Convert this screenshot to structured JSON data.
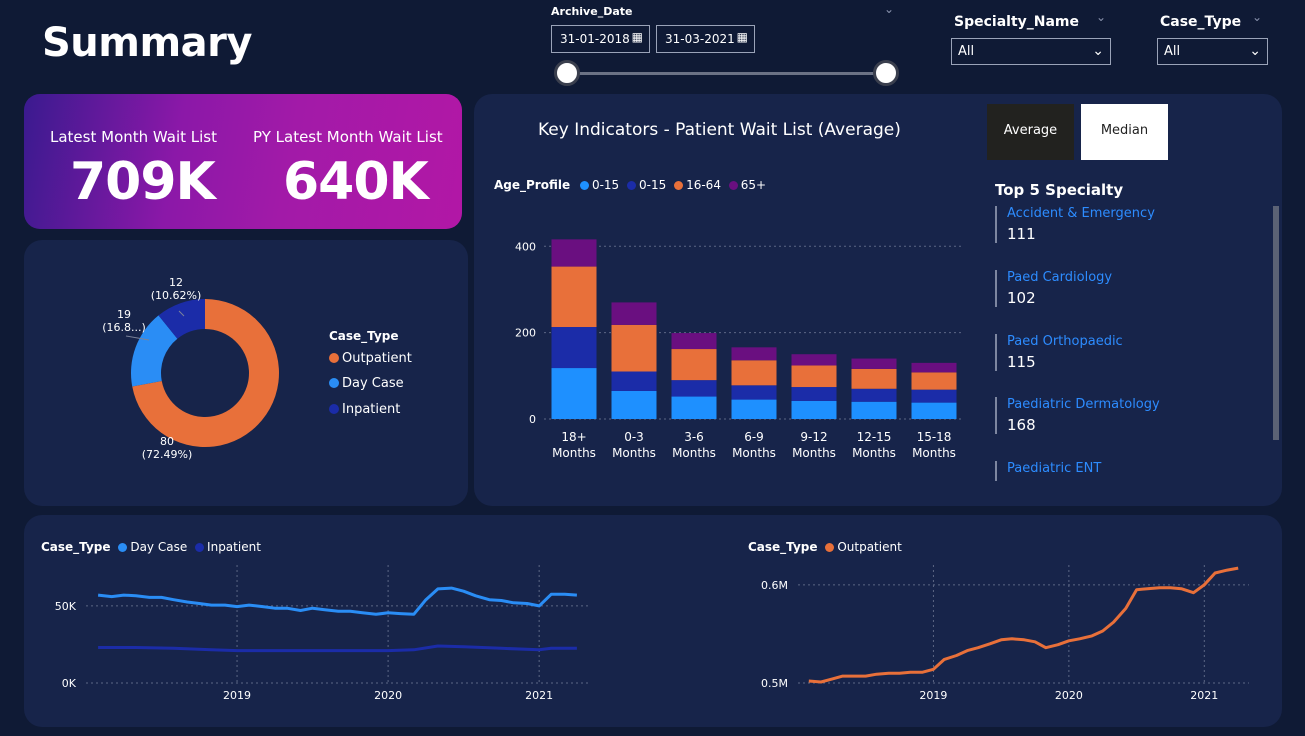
{
  "page_title": "Summary",
  "filters": {
    "archive_date": {
      "label": "Archive_Date",
      "start": "31-01-2018",
      "end": "31-03-2021"
    },
    "specialty": {
      "label": "Specialty_Name",
      "value": "All"
    },
    "case_type": {
      "label": "Case_Type",
      "value": "All"
    }
  },
  "kpis": [
    {
      "label": "Latest Month Wait List",
      "value": "709K"
    },
    {
      "label": "PY Latest Month Wait List",
      "value": "640K"
    }
  ],
  "key_indicators": {
    "title": "Key Indicators - Patient Wait List (Average)",
    "buttons": {
      "average": "Average",
      "median": "Median"
    },
    "legend_title": "Age_Profile"
  },
  "top5": {
    "title": "Top 5 Specialty",
    "items": [
      {
        "name": "Accident & Emergency",
        "value": "111"
      },
      {
        "name": "Paed Cardiology",
        "value": "102"
      },
      {
        "name": "Paed Orthopaedic",
        "value": "115"
      },
      {
        "name": "Paediatric Dermatology",
        "value": "168"
      },
      {
        "name": "Paediatric ENT",
        "value": ""
      }
    ]
  },
  "colors": {
    "outpatient": "#e8703a",
    "day_case": "#2a8df5",
    "inpatient": "#1b2ca8",
    "age_0_15_a": "#1e90ff",
    "age_0_15_b": "#1b2ca8",
    "age_16_64": "#e8703a",
    "age_65_plus": "#6a0f80"
  },
  "chart_data": [
    {
      "type": "pie",
      "legend_title": "Case_Type",
      "categories": [
        "Outpatient",
        "Day Case",
        "Inpatient"
      ],
      "values": [
        80,
        19,
        12
      ],
      "labels": [
        "80\n(72.49%)",
        "19\n(16.8...)",
        "12\n(10.62%)"
      ]
    },
    {
      "type": "bar",
      "stacked": true,
      "legend_title": "Age_Profile",
      "categories": [
        "18+ Months",
        "0-3 Months",
        "3-6 Months",
        "6-9 Months",
        "9-12 Months",
        "12-15 Months",
        "15-18 Months"
      ],
      "series": [
        {
          "name": "0-15",
          "values": [
            118,
            65,
            52,
            45,
            42,
            40,
            38
          ]
        },
        {
          "name": "0-15",
          "values": [
            95,
            45,
            38,
            33,
            32,
            30,
            30
          ]
        },
        {
          "name": "16-64",
          "values": [
            140,
            108,
            72,
            58,
            50,
            46,
            40
          ]
        },
        {
          "name": "65+",
          "values": [
            63,
            52,
            37,
            30,
            26,
            24,
            22
          ]
        }
      ],
      "yticks": [
        0,
        200,
        400
      ],
      "ylim": [
        0,
        440
      ]
    },
    {
      "type": "line",
      "legend_title": "Case_Type",
      "x_ticks": [
        "2019",
        "2020",
        "2021"
      ],
      "xlim": [
        2018.0,
        2021.33
      ],
      "yticks": [
        "0K",
        "50K"
      ],
      "ylim": [
        0,
        70000
      ],
      "series": [
        {
          "name": "Day Case",
          "x": [
            2018.08,
            2018.17,
            2018.25,
            2018.33,
            2018.42,
            2018.5,
            2018.58,
            2018.67,
            2018.75,
            2018.83,
            2018.92,
            2019.0,
            2019.08,
            2019.17,
            2019.25,
            2019.33,
            2019.42,
            2019.5,
            2019.58,
            2019.67,
            2019.75,
            2019.83,
            2019.92,
            2020.0,
            2020.08,
            2020.17,
            2020.25,
            2020.33,
            2020.42,
            2020.5,
            2020.58,
            2020.67,
            2020.75,
            2020.83,
            2020.92,
            2021.0,
            2021.08,
            2021.17,
            2021.25
          ],
          "y": [
            57000,
            56000,
            57000,
            56500,
            55500,
            55500,
            54000,
            52500,
            51500,
            50500,
            50500,
            49500,
            50500,
            49500,
            48500,
            48500,
            47000,
            48500,
            47500,
            46500,
            46500,
            45500,
            44500,
            45500,
            45000,
            44500,
            54000,
            61000,
            61500,
            59500,
            56500,
            54000,
            53500,
            52000,
            51500,
            50000,
            57500,
            57500,
            57000
          ]
        },
        {
          "name": "Inpatient",
          "x": [
            2018.08,
            2018.33,
            2018.58,
            2018.83,
            2019.0,
            2019.25,
            2019.5,
            2019.75,
            2020.0,
            2020.17,
            2020.33,
            2020.5,
            2020.75,
            2021.0,
            2021.08,
            2021.25
          ],
          "y": [
            23000,
            23000,
            22500,
            21500,
            21000,
            21000,
            21000,
            21000,
            21000,
            21500,
            24000,
            23500,
            22500,
            21500,
            22500,
            22500
          ]
        }
      ]
    },
    {
      "type": "line",
      "legend_title": "Case_Type",
      "x_ticks": [
        "2019",
        "2020",
        "2021"
      ],
      "xlim": [
        2018.0,
        2021.33
      ],
      "yticks": [
        "0.5M",
        "0.6M"
      ],
      "ylim": [
        0.5,
        0.61
      ],
      "series": [
        {
          "name": "Outpatient",
          "x": [
            2018.08,
            2018.17,
            2018.25,
            2018.33,
            2018.42,
            2018.5,
            2018.58,
            2018.67,
            2018.75,
            2018.83,
            2018.92,
            2019.0,
            2019.08,
            2019.17,
            2019.25,
            2019.33,
            2019.42,
            2019.5,
            2019.58,
            2019.67,
            2019.75,
            2019.83,
            2019.92,
            2020.0,
            2020.08,
            2020.17,
            2020.25,
            2020.33,
            2020.42,
            2020.5,
            2020.58,
            2020.67,
            2020.75,
            2020.83,
            2020.92,
            2021.0,
            2021.08,
            2021.17,
            2021.25
          ],
          "y": [
            0.502,
            0.501,
            0.504,
            0.507,
            0.507,
            0.507,
            0.509,
            0.51,
            0.51,
            0.511,
            0.511,
            0.514,
            0.524,
            0.528,
            0.533,
            0.536,
            0.54,
            0.544,
            0.545,
            0.544,
            0.542,
            0.536,
            0.539,
            0.543,
            0.545,
            0.548,
            0.553,
            0.562,
            0.576,
            0.595,
            0.596,
            0.597,
            0.597,
            0.596,
            0.592,
            0.6,
            0.612,
            0.615,
            0.617
          ]
        }
      ]
    }
  ]
}
